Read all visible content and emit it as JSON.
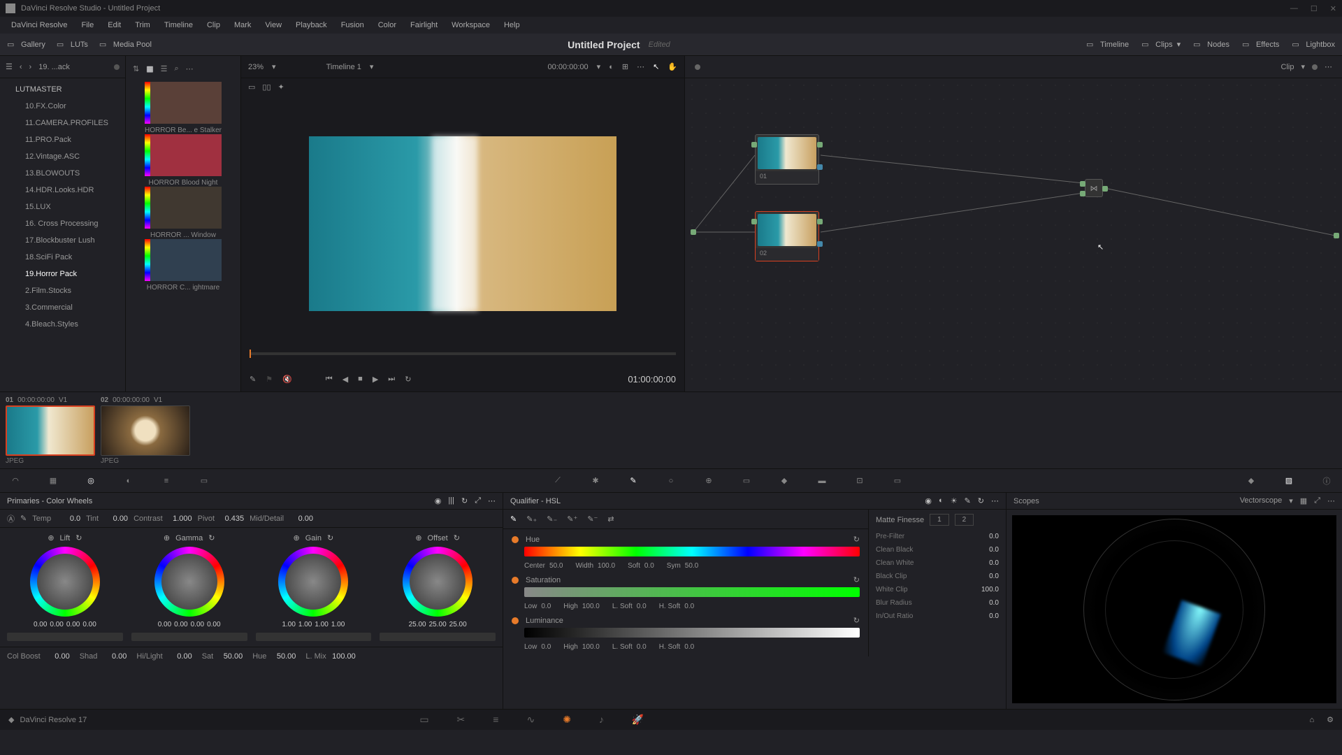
{
  "titlebar": {
    "app": "DaVinci Resolve Studio",
    "project": "Untitled Project"
  },
  "menu": [
    "DaVinci Resolve",
    "File",
    "Edit",
    "Trim",
    "Timeline",
    "Clip",
    "Mark",
    "View",
    "Playback",
    "Fusion",
    "Color",
    "Fairlight",
    "Workspace",
    "Help"
  ],
  "toolbar": {
    "left": [
      {
        "label": "Gallery"
      },
      {
        "label": "LUTs"
      },
      {
        "label": "Media Pool"
      }
    ],
    "center": {
      "title": "Untitled Project",
      "status": "Edited"
    },
    "right": [
      {
        "label": "Timeline"
      },
      {
        "label": "Clips"
      },
      {
        "label": "Nodes"
      },
      {
        "label": "Effects"
      },
      {
        "label": "Lightbox"
      }
    ]
  },
  "lut_breadcrumb": "19. ...ack",
  "lut_tree": [
    {
      "label": "LUTMASTER",
      "root": true
    },
    {
      "label": "10.FX.Color"
    },
    {
      "label": "11.CAMERA.PROFILES"
    },
    {
      "label": "11.PRO.Pack"
    },
    {
      "label": "12.Vintage.ASC"
    },
    {
      "label": "13.BLOWOUTS"
    },
    {
      "label": "14.HDR.Looks.HDR"
    },
    {
      "label": "15.LUX"
    },
    {
      "label": "16. Cross Processing"
    },
    {
      "label": "17.Blockbuster Lush"
    },
    {
      "label": "18.SciFi Pack"
    },
    {
      "label": "19.Horror Pack",
      "active": true
    },
    {
      "label": "2.Film.Stocks"
    },
    {
      "label": "3.Commercial"
    },
    {
      "label": "4.Bleach.Styles"
    }
  ],
  "lut_thumbs": [
    {
      "label": "HORROR Be... e Stalker",
      "tint": "#5a4038"
    },
    {
      "label": "HORROR Blood Night",
      "tint": "#a03040"
    },
    {
      "label": "HORROR ... Window",
      "tint": "#403830"
    },
    {
      "label": "HORROR C... ightmare",
      "tint": "#304050"
    }
  ],
  "viewer": {
    "zoom": "23%",
    "timeline": "Timeline 1",
    "tc_in": "00:00:00:00",
    "tc": "01:00:00:00"
  },
  "node_editor": {
    "mode": "Clip",
    "nodes": [
      {
        "id": "01"
      },
      {
        "id": "02",
        "selected": true
      }
    ]
  },
  "clips": [
    {
      "num": "01",
      "tc": "00:00:00:00",
      "track": "V1",
      "fmt": "JPEG",
      "selected": true,
      "bg": "linear-gradient(90deg,#1a7a8a,#2a9aa8 35%,#f0e8d0 48%,#c8a060)"
    },
    {
      "num": "02",
      "tc": "00:00:00:00",
      "track": "V1",
      "fmt": "JPEG",
      "bg": "radial-gradient(circle at 50% 50%,#f0e0c0 20%,#8a6a40 30%,#2a2018)"
    }
  ],
  "primaries": {
    "title": "Primaries - Color Wheels",
    "row1": {
      "temp": {
        "label": "Temp",
        "value": "0.0"
      },
      "tint": {
        "label": "Tint",
        "value": "0.00"
      },
      "contrast": {
        "label": "Contrast",
        "value": "1.000"
      },
      "pivot": {
        "label": "Pivot",
        "value": "0.435"
      },
      "md": {
        "label": "Mid/Detail",
        "value": "0.00"
      }
    },
    "wheels": [
      {
        "name": "Lift",
        "vals": [
          "0.00",
          "0.00",
          "0.00",
          "0.00"
        ]
      },
      {
        "name": "Gamma",
        "vals": [
          "0.00",
          "0.00",
          "0.00",
          "0.00"
        ]
      },
      {
        "name": "Gain",
        "vals": [
          "1.00",
          "1.00",
          "1.00",
          "1.00"
        ]
      },
      {
        "name": "Offset",
        "vals": [
          "25.00",
          "25.00",
          "25.00"
        ]
      }
    ],
    "row2": {
      "cb": {
        "label": "Col Boost",
        "value": "0.00"
      },
      "shad": {
        "label": "Shad",
        "value": "0.00"
      },
      "hl": {
        "label": "Hi/Light",
        "value": "0.00"
      },
      "sat": {
        "label": "Sat",
        "value": "50.00"
      },
      "hue": {
        "label": "Hue",
        "value": "50.00"
      },
      "lmix": {
        "label": "L. Mix",
        "value": "100.00"
      }
    }
  },
  "qualifier": {
    "title": "Qualifier - HSL",
    "hue": {
      "label": "Hue",
      "center": "50.0",
      "width": "100.0",
      "soft": "0.0",
      "sym": "50.0"
    },
    "sat": {
      "label": "Saturation",
      "low": "0.0",
      "high": "100.0",
      "lsoft": "0.0",
      "hsoft": "0.0"
    },
    "lum": {
      "label": "Luminance",
      "low": "0.0",
      "high": "100.0",
      "lsoft": "0.0",
      "hsoft": "0.0"
    }
  },
  "matte": {
    "title": "Matte Finesse",
    "tabs": [
      "1",
      "2"
    ],
    "rows": [
      {
        "label": "Pre-Filter",
        "value": "0.0"
      },
      {
        "label": "Clean Black",
        "value": "0.0"
      },
      {
        "label": "Clean White",
        "value": "0.0"
      },
      {
        "label": "Black Clip",
        "value": "0.0"
      },
      {
        "label": "White Clip",
        "value": "100.0"
      },
      {
        "label": "Blur Radius",
        "value": "0.0"
      },
      {
        "label": "In/Out Ratio",
        "value": "0.0"
      }
    ]
  },
  "scopes": {
    "title": "Scopes",
    "mode": "Vectorscope"
  },
  "footer": {
    "app": "DaVinci Resolve 17"
  }
}
